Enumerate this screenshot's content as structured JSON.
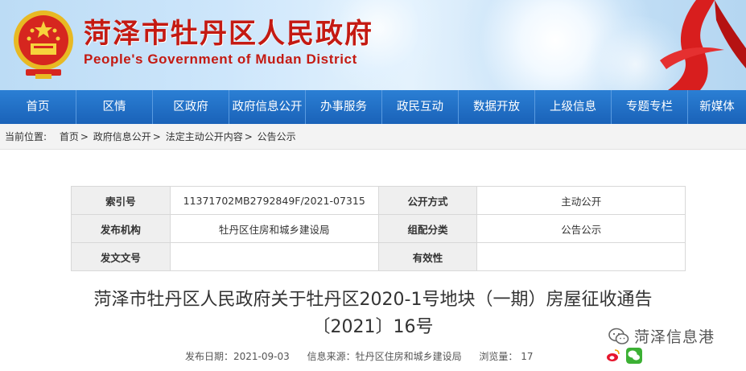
{
  "header": {
    "title": "菏泽市牡丹区人民政府",
    "subtitle": "People's Government of Mudan District"
  },
  "nav": [
    "首页",
    "区情",
    "区政府",
    "政府信息公开",
    "办事服务",
    "政民互动",
    "数据开放",
    "上级信息",
    "专题专栏",
    "新媒体"
  ],
  "breadcrumb": {
    "label": "当前位置:",
    "items": [
      "首页",
      "政府信息公开",
      "法定主动公开内容",
      "公告公示"
    ]
  },
  "info": {
    "index_label": "索引号",
    "index_value": "11371702MB2792849F/2021-07315",
    "open_mode_label": "公开方式",
    "open_mode_value": "主动公开",
    "publisher_label": "发布机构",
    "publisher_value": "牡丹区住房和城乡建设局",
    "category_label": "组配分类",
    "category_value": "公告公示",
    "doc_no_label": "发文文号",
    "doc_no_value": "",
    "validity_label": "有效性",
    "validity_value": ""
  },
  "article": {
    "title_line1": "菏泽市牡丹区人民政府关于牡丹区2020-1号地块（一期）房屋征收通告",
    "title_line2": "〔2021〕16号"
  },
  "meta": {
    "date": "发布日期：2021-09-03",
    "source": "信息来源：牡丹区住房和城乡建设局",
    "views": "浏览量： 17"
  },
  "watermark": {
    "text": "菏泽信息港"
  },
  "colors": {
    "brand_red": "#c41a12",
    "nav_blue": "#1a62b8"
  }
}
